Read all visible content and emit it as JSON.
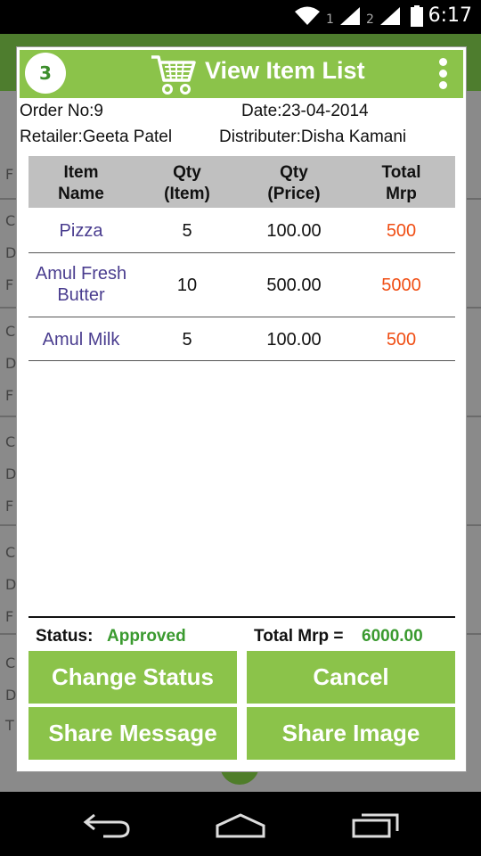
{
  "status_bar": {
    "time": "6:17",
    "sim1": "1",
    "sim2": "2"
  },
  "dialog": {
    "badge": "3",
    "title": "View Item List",
    "order_no": "Order No:9",
    "date": "Date:23-04-2014",
    "retailer": "Retailer:Geeta Patel",
    "distributer": "Distributer:Disha Kamani",
    "columns": [
      {
        "line1": "Item",
        "line2": "Name"
      },
      {
        "line1": "Qty",
        "line2": "(Item)"
      },
      {
        "line1": "Qty",
        "line2": "(Price)"
      },
      {
        "line1": "Total",
        "line2": "Mrp"
      }
    ],
    "rows": [
      {
        "name1": "Pizza",
        "name2": "",
        "qty": "5",
        "price": "100.00",
        "mrp": "500"
      },
      {
        "name1": "Amul Fresh",
        "name2": "Butter",
        "qty": "10",
        "price": "500.00",
        "mrp": "5000"
      },
      {
        "name1": "Amul Milk",
        "name2": "",
        "qty": "5",
        "price": "100.00",
        "mrp": "500"
      }
    ],
    "status_label": "Status:",
    "status_value": "Approved",
    "total_label": "Total Mrp =",
    "total_value": "6000.00",
    "buttons": {
      "change_status": "Change Status",
      "cancel": "Cancel",
      "share_message": "Share Message",
      "share_image": "Share Image"
    }
  },
  "background": {
    "letters": [
      "F",
      "C",
      "D",
      "F",
      "C",
      "D",
      "F",
      "C",
      "D",
      "F",
      "C",
      "D",
      "F",
      "C",
      "D",
      "T"
    ]
  },
  "colors": {
    "accent": "#8bc34a",
    "status_green": "#3a9a2f",
    "mrp_orange": "#f04e14",
    "item_purple": "#4a3d8f"
  },
  "icons": [
    "cart-icon",
    "overflow-icon",
    "wifi-icon",
    "signal-icon",
    "battery-icon",
    "back-icon",
    "home-icon",
    "recents-icon"
  ]
}
